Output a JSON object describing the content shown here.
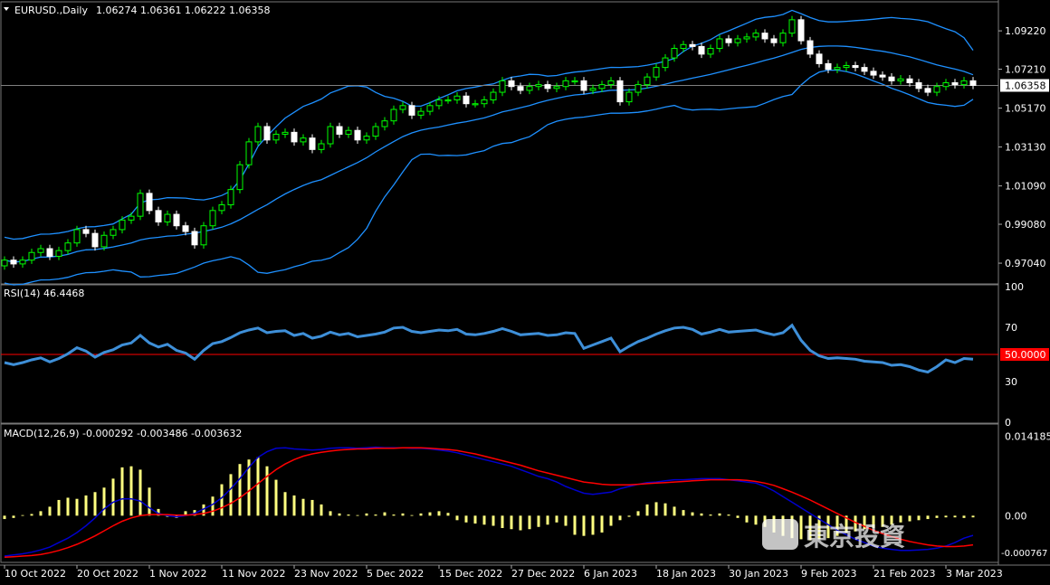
{
  "header": {
    "symbol": "EURUSD.,Daily",
    "ohlc": "1.06274 1.06361 1.06222 1.06358"
  },
  "chart_data": [
    {
      "type": "candlestick",
      "panel": "price",
      "ylim": [
        0.96,
        1.106
      ],
      "y_ticks": [
        0.9704,
        0.9908,
        1.0109,
        1.0313,
        1.0517,
        1.0721,
        1.0922
      ],
      "y_tick_labels": [
        "0.97040",
        "0.99080",
        "1.01090",
        "1.03130",
        "1.05170",
        "1.07210",
        "1.09220"
      ],
      "current_price_label": "1.06358",
      "current_price": 1.06358,
      "x_tick_labels": [
        "10 Oct 2022",
        "20 Oct 2022",
        "1 Nov 2022",
        "11 Nov 2022",
        "23 Nov 2022",
        "5 Dec 2022",
        "15 Dec 2022",
        "27 Dec 2022",
        "6 Jan 2023",
        "18 Jan 2023",
        "30 Jan 2023",
        "9 Feb 2023",
        "21 Feb 2023",
        "3 Mar 2023"
      ],
      "x_tick_index": [
        0,
        8,
        16,
        24,
        32,
        40,
        48,
        56,
        64,
        72,
        80,
        88,
        96,
        104
      ],
      "close": [
        0.972,
        0.97,
        0.972,
        0.976,
        0.978,
        0.974,
        0.977,
        0.981,
        0.988,
        0.986,
        0.979,
        0.985,
        0.988,
        0.993,
        0.995,
        1.007,
        0.998,
        0.992,
        0.996,
        0.99,
        0.987,
        0.98,
        0.99,
        0.998,
        1.001,
        1.009,
        1.022,
        1.034,
        1.042,
        1.035,
        1.038,
        1.039,
        1.034,
        1.036,
        1.03,
        1.033,
        1.042,
        1.038,
        1.04,
        1.035,
        1.037,
        1.042,
        1.045,
        1.051,
        1.053,
        1.048,
        1.05,
        1.053,
        1.056,
        1.056,
        1.058,
        1.054,
        1.054,
        1.056,
        1.06,
        1.066,
        1.063,
        1.061,
        1.063,
        1.064,
        1.062,
        1.063,
        1.066,
        1.066,
        1.061,
        1.062,
        1.064,
        1.066,
        1.055,
        1.06,
        1.064,
        1.068,
        1.073,
        1.078,
        1.083,
        1.085,
        1.084,
        1.08,
        1.083,
        1.088,
        1.086,
        1.088,
        1.089,
        1.091,
        1.088,
        1.086,
        1.091,
        1.098,
        1.087,
        1.08,
        1.075,
        1.072,
        1.073,
        1.074,
        1.073,
        1.071,
        1.069,
        1.068,
        1.066,
        1.067,
        1.065,
        1.062,
        1.06,
        1.063,
        1.065,
        1.064,
        1.066,
        1.0636
      ],
      "bollinger_bands": {
        "period": 20,
        "deviations": 2
      },
      "colors": {
        "bull": "#00ff00",
        "bear": "#ffffff",
        "bands": "#1e90ff",
        "grid_line": "#808080"
      }
    },
    {
      "type": "line",
      "panel": "rsi",
      "title": "RSI(14) 46.4468",
      "ylim": [
        0,
        100
      ],
      "y_ticks": [
        0,
        30,
        50,
        70,
        100
      ],
      "y_tick_labels": [
        "0",
        "30",
        "50.0000",
        "70",
        "100"
      ],
      "level": 50,
      "level_label": "50.0000",
      "values": [
        44.0,
        42.5,
        44.0,
        46.0,
        47.5,
        44.5,
        47.0,
        50.5,
        55.0,
        52.5,
        48.0,
        51.5,
        53.5,
        57.0,
        58.5,
        64.0,
        58.5,
        55.5,
        57.5,
        53.0,
        51.0,
        46.5,
        53.0,
        58.0,
        59.5,
        62.5,
        66.0,
        68.0,
        69.5,
        66.0,
        67.0,
        67.5,
        64.0,
        65.5,
        62.0,
        63.5,
        66.5,
        64.5,
        65.5,
        63.0,
        64.0,
        65.0,
        66.5,
        69.5,
        70.0,
        67.0,
        66.0,
        67.0,
        68.0,
        67.5,
        68.5,
        65.0,
        64.5,
        65.5,
        67.0,
        69.0,
        67.0,
        64.5,
        65.0,
        65.5,
        64.0,
        64.5,
        66.0,
        65.5,
        54.5,
        57.0,
        59.5,
        62.0,
        52.0,
        56.0,
        59.5,
        62.0,
        65.0,
        67.5,
        69.5,
        70.0,
        68.5,
        65.0,
        66.5,
        68.5,
        66.5,
        67.0,
        67.5,
        68.0,
        66.0,
        64.5,
        66.0,
        71.5,
        60.5,
        53.0,
        49.0,
        47.0,
        47.5,
        47.0,
        46.5,
        45.0,
        44.5,
        44.0,
        42.0,
        42.5,
        41.0,
        38.5,
        37.0,
        41.0,
        46.0,
        44.0,
        47.0,
        46.4468
      ],
      "colors": {
        "line": "#3e8fd8",
        "level": "#ff0000"
      }
    },
    {
      "type": "bar",
      "panel": "macd",
      "title": "MACD(12,26,9) -0.000292 -0.003486 -0.003632",
      "ylim": [
        -0.008,
        0.016
      ],
      "y_ticks": [
        0.0,
        0.014185
      ],
      "y_tick_labels": [
        "0.00",
        "0.014185"
      ],
      "y_tick_labels_partial": [
        "-0.000767"
      ],
      "histogram": [
        -0.0006,
        -0.0004,
        0.0001,
        0.0003,
        0.0008,
        0.0016,
        0.0028,
        0.0032,
        0.003,
        0.0036,
        0.0042,
        0.005,
        0.0066,
        0.0086,
        0.0088,
        0.0082,
        0.005,
        0.0012,
        -0.0002,
        -0.0004,
        0.0008,
        0.001,
        0.002,
        0.0034,
        0.0056,
        0.0074,
        0.0092,
        0.01,
        0.0104,
        0.0088,
        0.0064,
        0.0042,
        0.0036,
        0.003,
        0.0028,
        0.002,
        0.0008,
        0.0004,
        0.0002,
        0.0001,
        0.0004,
        0.0002,
        0.0006,
        0.0002,
        0.0004,
        0.0001,
        0.0004,
        0.0006,
        0.0008,
        0.0005,
        -0.0008,
        -0.0012,
        -0.0014,
        -0.0016,
        -0.0018,
        -0.0022,
        -0.0024,
        -0.0026,
        -0.0024,
        -0.002,
        -0.0016,
        -0.0012,
        -0.0018,
        -0.0034,
        -0.0036,
        -0.0034,
        -0.003,
        -0.0018,
        -0.0008,
        -0.0002,
        0.0008,
        0.002,
        0.0024,
        0.0022,
        0.0016,
        0.001,
        0.0006,
        0.0004,
        0.0002,
        0.0004,
        0.0002,
        -0.0004,
        -0.0012,
        -0.0016,
        -0.002,
        -0.003,
        -0.0036,
        -0.004,
        -0.0042,
        -0.0044,
        -0.0042,
        -0.004,
        -0.0036,
        -0.003,
        -0.0028,
        -0.0024,
        -0.0022,
        -0.002,
        -0.0016,
        -0.0012,
        -0.001,
        -0.0008,
        -0.0006,
        -0.0004,
        -0.0003,
        -0.0003,
        -0.0004,
        -0.0003
      ],
      "macd_line": [
        -0.0072,
        -0.007,
        -0.0068,
        -0.0065,
        -0.0061,
        -0.0056,
        -0.0048,
        -0.004,
        -0.003,
        -0.0018,
        -0.0004,
        0.0012,
        0.0024,
        0.003,
        0.003,
        0.0026,
        0.0014,
        0.0004,
        0.0,
        -0.0002,
        0.0,
        0.0004,
        0.0012,
        0.002,
        0.0032,
        0.0048,
        0.0066,
        0.0086,
        0.0104,
        0.0114,
        0.012,
        0.0121,
        0.0119,
        0.0118,
        0.0117,
        0.0118,
        0.012,
        0.0121,
        0.0121,
        0.012,
        0.0121,
        0.0122,
        0.0121,
        0.0121,
        0.0121,
        0.012,
        0.012,
        0.0119,
        0.0117,
        0.0115,
        0.0112,
        0.0108,
        0.0104,
        0.01,
        0.0096,
        0.0092,
        0.0088,
        0.0082,
        0.0076,
        0.007,
        0.0066,
        0.006,
        0.0052,
        0.0046,
        0.004,
        0.0038,
        0.004,
        0.0042,
        0.0048,
        0.0052,
        0.0056,
        0.0059,
        0.006,
        0.0062,
        0.0064,
        0.0064,
        0.0065,
        0.0066,
        0.0066,
        0.0066,
        0.0064,
        0.0062,
        0.006,
        0.0058,
        0.0052,
        0.0044,
        0.0034,
        0.0024,
        0.0014,
        0.0004,
        -0.0006,
        -0.0016,
        -0.0026,
        -0.0034,
        -0.0042,
        -0.0048,
        -0.0054,
        -0.0058,
        -0.006,
        -0.0062,
        -0.0062,
        -0.0061,
        -0.006,
        -0.0058,
        -0.0054,
        -0.0048,
        -0.004,
        -0.0035
      ],
      "signal_line": [
        -0.0074,
        -0.0073,
        -0.0072,
        -0.0071,
        -0.0069,
        -0.0066,
        -0.0062,
        -0.0057,
        -0.0051,
        -0.0044,
        -0.0036,
        -0.0027,
        -0.0018,
        -0.001,
        -0.0004,
        0.0,
        0.0002,
        0.0002,
        0.0002,
        0.0001,
        0.0001,
        0.0002,
        0.0004,
        0.0008,
        0.0014,
        0.0022,
        0.0032,
        0.0044,
        0.0057,
        0.007,
        0.0082,
        0.0092,
        0.01,
        0.0106,
        0.011,
        0.0113,
        0.0115,
        0.0117,
        0.0118,
        0.0119,
        0.0119,
        0.012,
        0.012,
        0.012,
        0.0121,
        0.0121,
        0.0121,
        0.012,
        0.0119,
        0.0118,
        0.0116,
        0.0113,
        0.011,
        0.0106,
        0.0102,
        0.0098,
        0.0094,
        0.009,
        0.0085,
        0.008,
        0.0076,
        0.0072,
        0.0068,
        0.0064,
        0.006,
        0.0058,
        0.0056,
        0.0055,
        0.0055,
        0.0055,
        0.0056,
        0.0057,
        0.0058,
        0.0059,
        0.006,
        0.0061,
        0.0062,
        0.0063,
        0.0064,
        0.0064,
        0.0064,
        0.0064,
        0.0063,
        0.0061,
        0.0058,
        0.0054,
        0.0048,
        0.0042,
        0.0035,
        0.0028,
        0.002,
        0.0012,
        0.0004,
        -0.0004,
        -0.0012,
        -0.0019,
        -0.0026,
        -0.0032,
        -0.0037,
        -0.0042,
        -0.0046,
        -0.0049,
        -0.0052,
        -0.0054,
        -0.0055,
        -0.0055,
        -0.0054,
        -0.0052
      ],
      "colors": {
        "histogram": "#ffff80",
        "macd": "#0000cd",
        "signal": "#ff0000"
      }
    }
  ],
  "watermark": {
    "text": "東京投資"
  }
}
